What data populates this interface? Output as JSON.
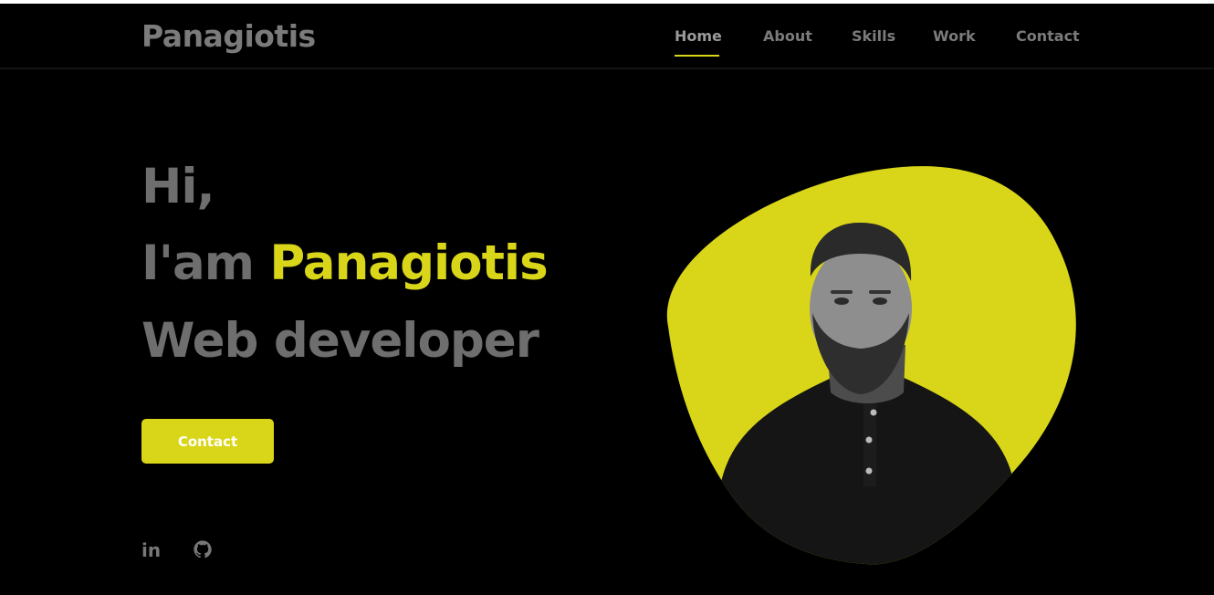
{
  "header": {
    "logo": "Panagiotis",
    "nav": [
      {
        "label": "Home",
        "active": true
      },
      {
        "label": "About",
        "active": false
      },
      {
        "label": "Skills",
        "active": false
      },
      {
        "label": "Work",
        "active": false
      },
      {
        "label": "Contact",
        "active": false
      }
    ]
  },
  "hero": {
    "greeting": "Hi,",
    "intro_prefix": "I'am ",
    "name": "Panagiotis",
    "role": "Web developer",
    "cta_label": "Contact"
  },
  "social": {
    "linkedin_label": "in",
    "github_icon": "github-icon"
  },
  "portrait": {
    "description_icon": "portrait-photo"
  },
  "colors": {
    "accent": "#d9d619",
    "background": "#000000",
    "text_muted": "#7b7b7b"
  }
}
